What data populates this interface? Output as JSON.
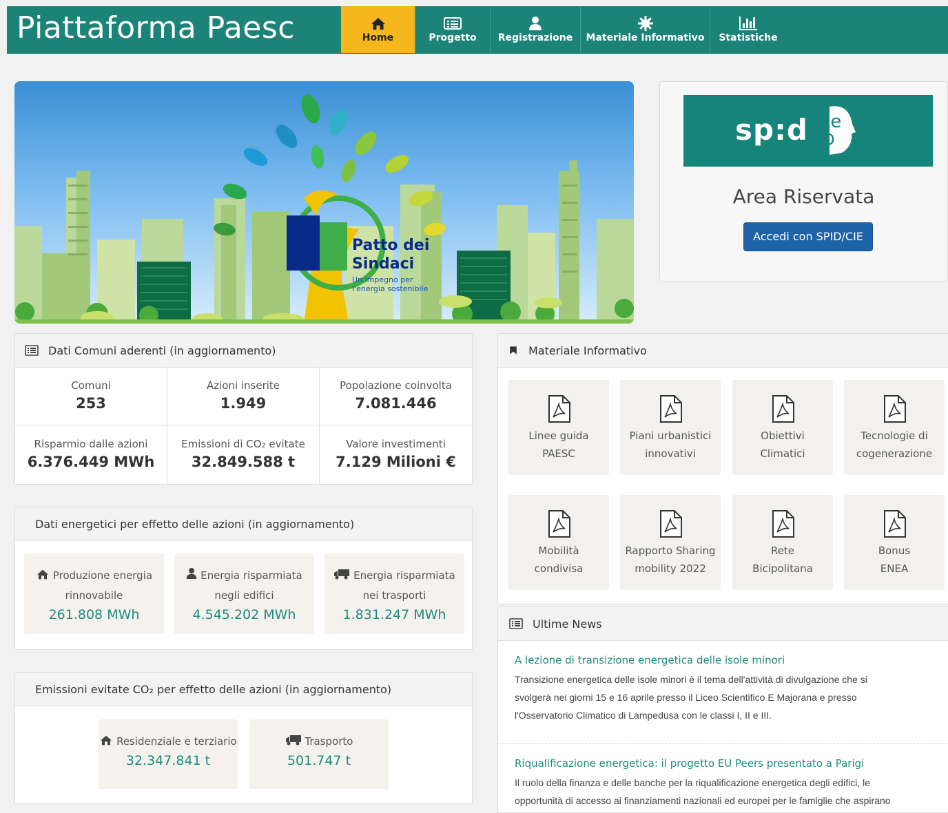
{
  "brand": "Piattaforma Paesc",
  "nav": [
    {
      "label": "Home",
      "icon": "home-icon"
    },
    {
      "label": "Progetto",
      "icon": "list-icon"
    },
    {
      "label": "Registrazione",
      "icon": "user-icon"
    },
    {
      "label": "Materiale Informativo",
      "icon": "gear-icon"
    },
    {
      "label": "Statistiche",
      "icon": "bar-chart-icon"
    }
  ],
  "hero": {
    "logo_title_1": "Patto dei",
    "logo_title_2": "Sindaci",
    "logo_sub_1": "Un impegno per",
    "logo_sub_2": "l'energia sostenibile"
  },
  "login": {
    "spid_text": "sp:d",
    "cie_text_1": "Cie",
    "cie_text_2": "ID",
    "title": "Area Riservata",
    "button": "Accedi con SPID/CIE"
  },
  "comuni_panel": {
    "title": "Dati Comuni aderenti (in aggiornamento)",
    "stats": [
      {
        "label": "Comuni",
        "value": "253"
      },
      {
        "label": "Azioni inserite",
        "value": "1.949"
      },
      {
        "label": "Popolazione coinvolta",
        "value": "7.081.446"
      },
      {
        "label": "Risparmio dalle azioni",
        "value": "6.376.449 MWh"
      },
      {
        "label": "Emissioni di CO₂ evitate",
        "value": "32.849.588 t"
      },
      {
        "label": "Valore investimenti",
        "value": "7.129 Milioni €"
      }
    ]
  },
  "energy_panel": {
    "title": "Dati energetici per effetto delle azioni (in aggiornamento)",
    "cards": [
      {
        "icon": "home-icon",
        "label_1": "Produzione energia",
        "label_2": "rinnovabile",
        "value": "261.808 MWh"
      },
      {
        "icon": "user-icon",
        "label_1": "Energia risparmiata",
        "label_2": "negli edifici",
        "value": "4.545.202 MWh"
      },
      {
        "icon": "truck-icon",
        "label_1": "Energia risparmiata",
        "label_2": "nei trasporti",
        "value": "1.831.247 MWh"
      }
    ]
  },
  "emissions_panel": {
    "title": "Emissioni evitate CO₂ per effetto delle azioni (in aggiornamento)",
    "cards": [
      {
        "icon": "home-icon",
        "label": "Residenziale e terziario",
        "value": "32.347.841 t"
      },
      {
        "icon": "truck-icon",
        "label": "Trasporto",
        "value": "501.747 t"
      }
    ]
  },
  "materiale_panel": {
    "title": "Materiale Informativo",
    "docs": [
      {
        "line1": "Linee guida",
        "line2": "PAESC"
      },
      {
        "line1": "Piani urbanistici",
        "line2": "innovativi"
      },
      {
        "line1": "Obiettivi",
        "line2": "Climatici"
      },
      {
        "line1": "Tecnologie di",
        "line2": "cogenerazione"
      },
      {
        "line1": "Mobilità",
        "line2": "condivisa"
      },
      {
        "line1": "Rapporto Sharing",
        "line2": "mobility 2022"
      },
      {
        "line1": "Rete",
        "line2": "Bicipolitana"
      },
      {
        "line1": "Bonus",
        "line2": "ENEA"
      }
    ]
  },
  "news_panel": {
    "title": "Ultime News",
    "items": [
      {
        "title": "A lezione di transizione energetica delle isole minori",
        "lines": [
          "Transizione energetica delle isole minori è il tema dell'attività di divulgazione che si",
          "svolgerà nei giorni 15 e 16 aprile presso il Liceo Scientifico E Majorana e presso",
          "l'Osservatorio Climatico di Lampedusa con le classi I, II e III."
        ]
      },
      {
        "title": "Riqualificazione energetica: il progetto EU Peers presentato a Parigi",
        "lines": [
          "Il ruolo della finanza e delle banche per la riqualificazione energetica degli edifici, le",
          "opportunità di accesso ai finanziamenti nazionali ed europei per le famiglie che aspirano"
        ]
      }
    ]
  },
  "colors": {
    "brand_teal": "#1b8378",
    "active_tab": "#f5b71d",
    "button_blue": "#1f63a7",
    "value_teal": "#1d8a80"
  }
}
